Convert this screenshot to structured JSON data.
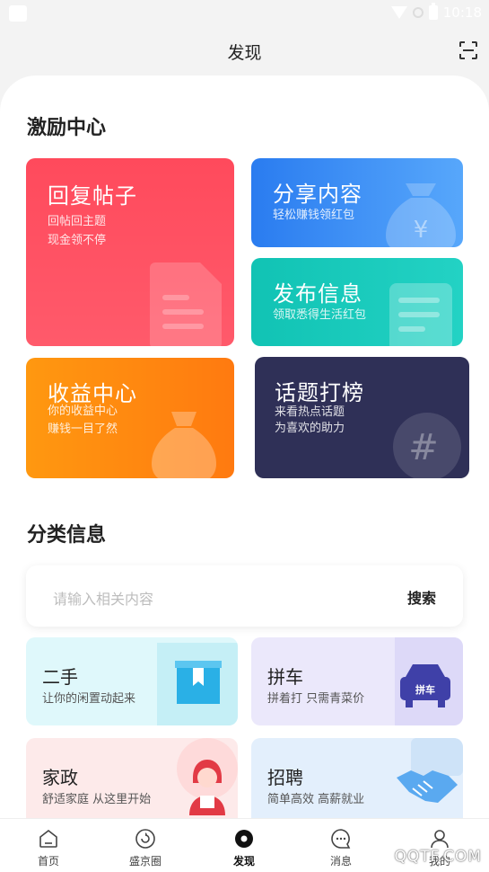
{
  "status_bar": {
    "time": "10:18"
  },
  "header": {
    "title": "发现"
  },
  "incentive": {
    "title": "激励中心",
    "cards": [
      {
        "title": "回复帖子",
        "lines": [
          "回帖回主题",
          "现金领不停"
        ]
      },
      {
        "title": "分享内容",
        "lines": [
          "轻松赚钱领红包"
        ],
        "icon_text": "¥"
      },
      {
        "title": "发布信息",
        "lines": [
          "领取悉得生活红包"
        ]
      },
      {
        "title": "收益中心",
        "lines": [
          "你的收益中心",
          "赚钱一目了然"
        ]
      },
      {
        "title": "话题打榜",
        "lines": [
          "来看热点话题",
          "为喜欢的助力"
        ],
        "icon_text": "#"
      }
    ]
  },
  "category": {
    "title": "分类信息",
    "search": {
      "placeholder": "请输入相关内容",
      "button": "搜索"
    },
    "items": [
      {
        "title": "二手",
        "sub": "让你的闲置动起来"
      },
      {
        "title": "拼车",
        "sub": "拼着打 只需青菜价",
        "icon_text": "拼车"
      },
      {
        "title": "家政",
        "sub": "舒适家庭 从这里开始"
      },
      {
        "title": "招聘",
        "sub": "简单高效 高薪就业"
      }
    ]
  },
  "tabbar": {
    "tabs": [
      {
        "label": "首页"
      },
      {
        "label": "盛京圈"
      },
      {
        "label": "发现"
      },
      {
        "label": "消息"
      },
      {
        "label": "我的"
      }
    ]
  },
  "watermark": "QQTF.COM",
  "colors": {
    "reply": "#ff4a5c",
    "share": "#2a7cf0",
    "publish": "#11c3b4",
    "income": "#ff8c10",
    "topic": "#2f3057"
  }
}
